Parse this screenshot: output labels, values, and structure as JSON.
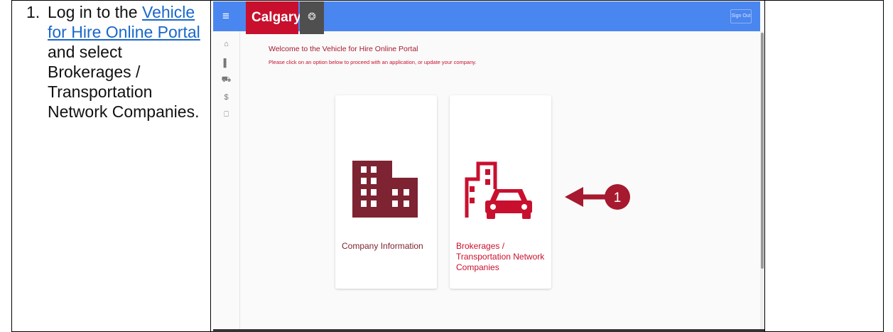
{
  "instructions": {
    "step_number": "1.",
    "text_before_link": "Log in to the",
    "link_text": "Vehicle for Hire Online Portal",
    "text_after_link": "and select Brokerages / Transportation Network Companies."
  },
  "portal": {
    "logo_text": "Calgary",
    "crest_glyph": "❂",
    "sign_out_label": "Sign Out",
    "welcome_title": "Welcome to the Vehicle for Hire Online Portal",
    "welcome_subtext": "Please click on an option below to proceed with an application, or update your company.",
    "sidebar_icons": [
      "menu-icon",
      "home-icon",
      "building-icon",
      "vehicle-icon",
      "dollar-icon",
      "lock-icon"
    ],
    "sidebar_glyphs": [
      "≡",
      "⌂",
      "▌",
      "⛟",
      "$",
      "⎕"
    ],
    "cards": [
      {
        "label": "Company Information",
        "icon": "building-icon",
        "color": "#7d2331"
      },
      {
        "label": "Brokerages / Transportation Network Companies",
        "icon": "building-car-icon",
        "color": "#c8102e"
      }
    ],
    "callout_number": "1",
    "colors": {
      "topbar": "#4a86f0",
      "brand_red": "#c8102e",
      "maroon": "#7d2331"
    }
  }
}
